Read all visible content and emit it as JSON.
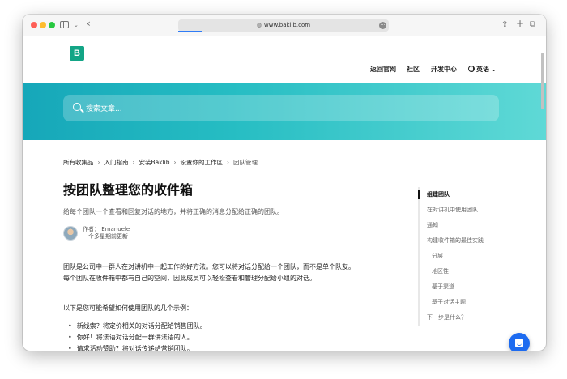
{
  "browser": {
    "url": "www.baklib.com",
    "back_icon": "chevron-left-icon",
    "share_icon": "share-icon",
    "new_tab_icon": "plus-icon",
    "tabs_icon": "tabs-icon"
  },
  "header": {
    "logo_letter": "B",
    "nav": {
      "home": "返回官网",
      "community": "社区",
      "dev": "开发中心",
      "language": "英语"
    }
  },
  "search": {
    "placeholder": "搜索文章..."
  },
  "breadcrumb": [
    "所有收集品",
    "入门指南",
    "安装Baklib",
    "设置你的工作区",
    "团队管理"
  ],
  "article": {
    "title": "按团队整理您的收件箱",
    "subtitle": "给每个团队一个查看和回复对话的地方，并将正确的消息分配给正确的团队。",
    "author_label": "作者：  Emanuele",
    "updated": "一个多星期前更新",
    "paragraph": "团队是公司中一群人在对讲机中一起工作的好方法。您可以将对话分配给一个团队，而不是单个队友。每个团队在收件箱中都有自己的空间，因此成员可以轻松查看和管理分配给小组的对话。",
    "examples_intro": "以下是您可能希望如何使用团队的几个示例：",
    "examples": [
      "新线索？将定价相关的对话分配给销售团队。",
      "你好！将法语对话分配一群讲法语的人。",
      "请求活动赞助？将对话传递给营销团队。"
    ]
  },
  "toc": [
    {
      "label": "组建团队",
      "level": 1,
      "active": true
    },
    {
      "label": "在对讲机中使用团队",
      "level": 1
    },
    {
      "label": "通知",
      "level": 1
    },
    {
      "label": "构建收件箱的最佳实践",
      "level": 1
    },
    {
      "label": "分层",
      "level": 2
    },
    {
      "label": "地区性",
      "level": 2
    },
    {
      "label": "基于渠道",
      "level": 2
    },
    {
      "label": "基于对话主题",
      "level": 2
    },
    {
      "label": "下一步是什么？",
      "level": 1
    }
  ],
  "colors": {
    "brand": "#13a586",
    "hero_start": "#16a7b9",
    "hero_end": "#5fd9d6",
    "chat_button": "#1d6bf0"
  }
}
